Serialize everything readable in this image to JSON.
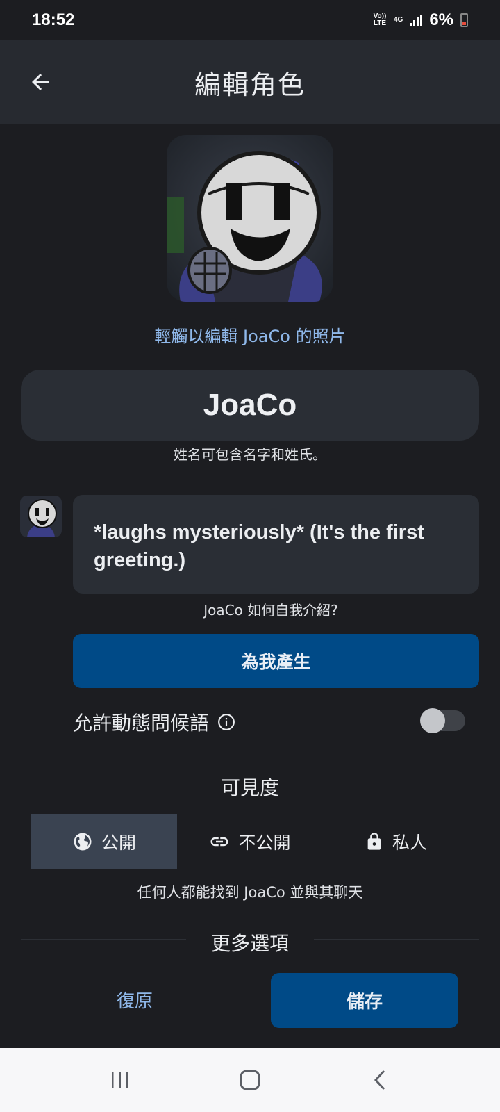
{
  "status_bar": {
    "time": "18:52",
    "volte": "Vo)) LTE",
    "network": "4G",
    "battery": "6%"
  },
  "app_bar": {
    "title": "編輯角色",
    "back_icon": "arrow-left-icon"
  },
  "character": {
    "photo_caption": "輕觸以編輯 JoaCo 的照片",
    "name_value": "JoaCo",
    "name_help": "姓名可包含名字和姓氏。",
    "greeting_value": "*laughs mysteriously* (It's the first greeting.)",
    "greeting_help": "JoaCo 如何自我介紹?",
    "generate_label": "為我產生"
  },
  "dynamic_greetings": {
    "label": "允許動態問候語",
    "enabled": false
  },
  "visibility": {
    "title": "可見度",
    "tabs": [
      {
        "label": "公開",
        "icon": "globe-icon",
        "selected": true
      },
      {
        "label": "不公開",
        "icon": "link-icon",
        "selected": false
      },
      {
        "label": "私人",
        "icon": "lock-icon",
        "selected": false
      }
    ],
    "help": "任何人都能找到 JoaCo 並與其聊天"
  },
  "more_options": {
    "title": "更多選項"
  },
  "actions": {
    "restore_label": "復原",
    "save_label": "儲存"
  },
  "colors": {
    "background": "#1c1d21",
    "surface": "#2a2e35",
    "primary": "#004a87",
    "link": "#8fb8ea"
  }
}
